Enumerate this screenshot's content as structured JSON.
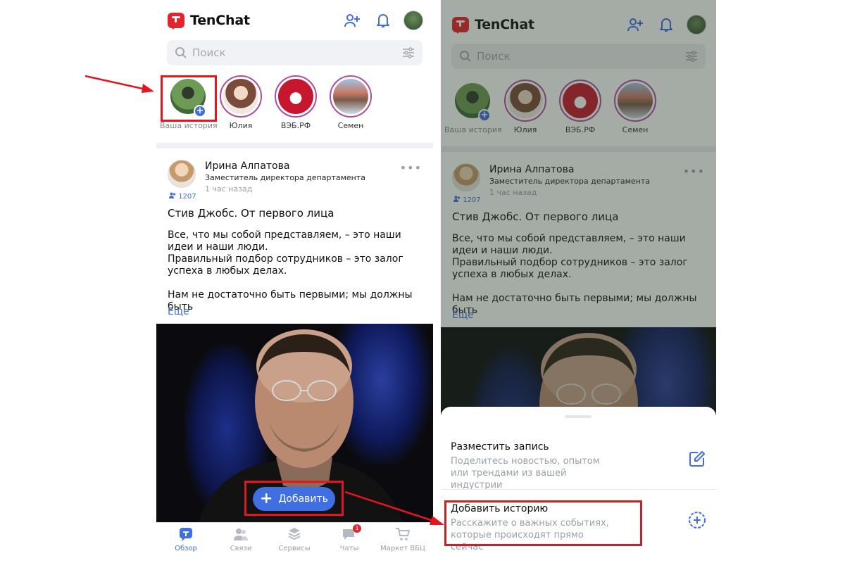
{
  "app": {
    "name": "TenChat"
  },
  "search": {
    "placeholder": "Поиск"
  },
  "stories": [
    {
      "label": "Ваша история"
    },
    {
      "label": "Юлия"
    },
    {
      "label": "ВЭБ.РФ"
    },
    {
      "label": "Семен"
    }
  ],
  "post": {
    "author": "Ирина Алпатова",
    "role": "Заместитель директора департамента",
    "time": "1 час назад",
    "followers": "1207",
    "title": "Стив Джобс. От первого лица",
    "paragraphs": [
      "Все, что мы собой представляем, – это наши идеи и наши люди.\nПравильный подбор сотрудников – это залог успеха в любых делах.",
      "Нам не достаточно быть первыми; мы должны быть"
    ],
    "more": "Еще"
  },
  "add_button": {
    "label": "Добавить"
  },
  "tabs": [
    {
      "label": "Обзор",
      "icon": "overview-icon"
    },
    {
      "label": "Связи",
      "icon": "contacts-icon"
    },
    {
      "label": "Сервисы",
      "icon": "services-icon"
    },
    {
      "label": "Чаты",
      "icon": "chat-icon",
      "badge": "1"
    },
    {
      "label": "Маркет ВБЦ",
      "icon": "cart-icon"
    }
  ],
  "sheet": {
    "items": [
      {
        "title": "Разместить запись",
        "subtitle": "Поделитесь новостью, опытом или трендами из вашей индустрии",
        "icon": "edit-icon"
      },
      {
        "title": "Добавить историю",
        "subtitle": "Расскажите о важных событиях, которые происходят прямо сейчас",
        "icon": "add-circle-icon"
      }
    ]
  },
  "colors": {
    "brand": "#e3232e",
    "accent": "#3f6fe0",
    "annotation": "#e3161f"
  }
}
